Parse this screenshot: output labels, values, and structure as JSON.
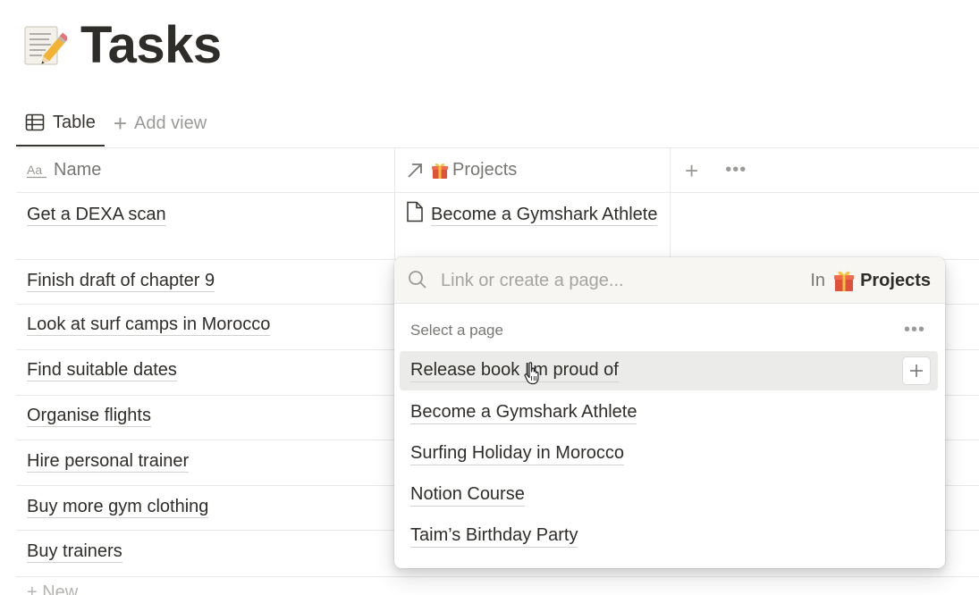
{
  "page": {
    "icon": "memo-pencil-icon",
    "title": "Tasks"
  },
  "views": {
    "active_tab": {
      "label": "Table",
      "icon": "table-icon"
    },
    "add_view_label": "Add view"
  },
  "table": {
    "columns": [
      {
        "label": "Name",
        "icon": "text-property-icon"
      },
      {
        "label": "Projects",
        "icon": "relation-arrow-icon",
        "emoji": "gift-icon"
      }
    ],
    "rows": [
      {
        "name": "Get a DEXA scan",
        "project": "Become a Gymshark Athlete"
      },
      {
        "name": "Finish draft of chapter 9"
      },
      {
        "name": "Look at surf camps in Morocco"
      },
      {
        "name": "Find suitable dates"
      },
      {
        "name": "Organise flights"
      },
      {
        "name": "Hire personal trainer"
      },
      {
        "name": "Buy more gym clothing"
      },
      {
        "name": "Buy trainers"
      }
    ],
    "new_row_label": "+ New"
  },
  "relation_popup": {
    "search_placeholder": "Link or create a page...",
    "in_label": "In",
    "database_name": "Projects",
    "section_label": "Select a page",
    "options": [
      "Release book I'm proud of",
      "Become a Gymshark Athlete",
      "Surfing Holiday in Morocco",
      "Notion Course",
      "Taim’s Birthday Party"
    ]
  },
  "colors": {
    "text": "#37352f",
    "muted": "#787774",
    "border": "#e9e9e7",
    "hover": "#ebebea"
  }
}
